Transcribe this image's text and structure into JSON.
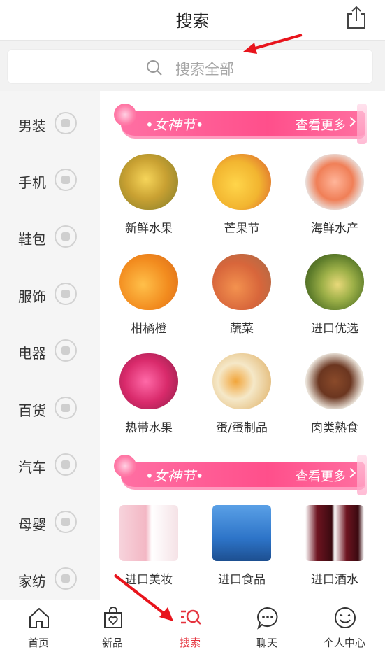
{
  "header": {
    "title": "搜索",
    "share_icon": "share-icon"
  },
  "search": {
    "placeholder": "搜索全部",
    "icon": "search-icon"
  },
  "categories": [
    {
      "label": "男装",
      "icon": "tie-icon"
    },
    {
      "label": "手机",
      "icon": "phone-icon"
    },
    {
      "label": "鞋包",
      "icon": "shoe-icon"
    },
    {
      "label": "服饰",
      "icon": "shirt-icon"
    },
    {
      "label": "电器",
      "icon": "appliance-icon"
    },
    {
      "label": "百货",
      "icon": "umbrella-icon"
    },
    {
      "label": "汽车",
      "icon": "car-icon"
    },
    {
      "label": "母婴",
      "icon": "baby-bottle-icon"
    },
    {
      "label": "家纺",
      "icon": "lamp-icon"
    }
  ],
  "sections": [
    {
      "banner": {
        "festival": "•女神节•",
        "more": "查看更多"
      },
      "items": [
        {
          "name": "新鲜水果",
          "color": "#caa12f"
        },
        {
          "name": "芒果节",
          "color": "#f2b530"
        },
        {
          "name": "海鲜水产",
          "color": "#f07f57"
        },
        {
          "name": "柑橘橙",
          "color": "#f28b1e"
        },
        {
          "name": "蔬菜",
          "color": "#d8663b"
        },
        {
          "name": "进口优选",
          "color": "#5e7d2b"
        },
        {
          "name": "热带水果",
          "color": "#d92a6b"
        },
        {
          "name": "蛋/蛋制品",
          "color": "#e7c489"
        },
        {
          "name": "肉类熟食",
          "color": "#8a4a2a"
        }
      ]
    },
    {
      "banner": {
        "festival": "•女神节•",
        "more": "查看更多"
      },
      "items": [
        {
          "name": "进口美妆",
          "color": "#f3b7c4"
        },
        {
          "name": "进口食品",
          "color": "#2d74c8"
        },
        {
          "name": "进口酒水",
          "color": "#6e1420"
        }
      ]
    }
  ],
  "tabbar": [
    {
      "label": "首页",
      "icon": "home-icon"
    },
    {
      "label": "新品",
      "icon": "bag-icon"
    },
    {
      "label": "搜索",
      "icon": "search-tab-icon",
      "active": true
    },
    {
      "label": "聊天",
      "icon": "chat-icon"
    },
    {
      "label": "个人中心",
      "icon": "profile-icon"
    }
  ],
  "colors": {
    "accent": "#e5343f",
    "banner": "#ff4f8b",
    "arrow": "#e8141c"
  }
}
